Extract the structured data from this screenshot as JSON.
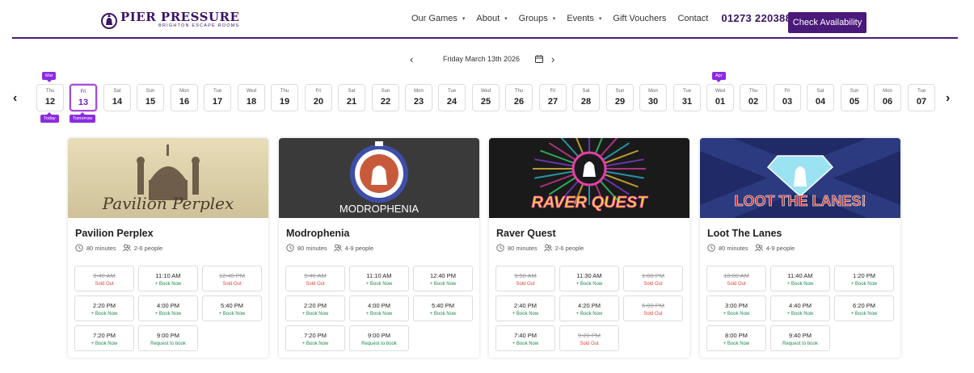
{
  "brand": {
    "name": "PIER PRESSURE",
    "tagline": "BRIGHTON ESCAPE ROOMS"
  },
  "nav": {
    "items": [
      {
        "label": "Our Games",
        "caret": true
      },
      {
        "label": "About",
        "caret": true
      },
      {
        "label": "Groups",
        "caret": true
      },
      {
        "label": "Events",
        "caret": true
      },
      {
        "label": "Gift Vouchers",
        "caret": false
      },
      {
        "label": "Contact",
        "caret": false
      }
    ],
    "phone": "01273 220388",
    "cta": "Check Availability"
  },
  "date_nav": {
    "current": "Friday March 13th 2026"
  },
  "days": [
    {
      "dn": "Thu",
      "dd": "12",
      "top_tag": "Mar",
      "bottom_tag": "Today"
    },
    {
      "dn": "Fri",
      "dd": "13",
      "bottom_tag": "Tomorrow",
      "selected": true
    },
    {
      "dn": "Sat",
      "dd": "14"
    },
    {
      "dn": "Sun",
      "dd": "15"
    },
    {
      "dn": "Mon",
      "dd": "16"
    },
    {
      "dn": "Tue",
      "dd": "17"
    },
    {
      "dn": "Wed",
      "dd": "18"
    },
    {
      "dn": "Thu",
      "dd": "19"
    },
    {
      "dn": "Fri",
      "dd": "20"
    },
    {
      "dn": "Sat",
      "dd": "21"
    },
    {
      "dn": "Sun",
      "dd": "22"
    },
    {
      "dn": "Mon",
      "dd": "23"
    },
    {
      "dn": "Tue",
      "dd": "24"
    },
    {
      "dn": "Wed",
      "dd": "25"
    },
    {
      "dn": "Thu",
      "dd": "26"
    },
    {
      "dn": "Fri",
      "dd": "27"
    },
    {
      "dn": "Sat",
      "dd": "28"
    },
    {
      "dn": "Sun",
      "dd": "29"
    },
    {
      "dn": "Mon",
      "dd": "30"
    },
    {
      "dn": "Tue",
      "dd": "31"
    },
    {
      "dn": "Wed",
      "dd": "01",
      "top_tag": "Apr"
    },
    {
      "dn": "Thu",
      "dd": "02"
    },
    {
      "dn": "Fri",
      "dd": "03"
    },
    {
      "dn": "Sat",
      "dd": "04"
    },
    {
      "dn": "Sun",
      "dd": "05"
    },
    {
      "dn": "Mon",
      "dd": "06"
    },
    {
      "dn": "Tue",
      "dd": "07"
    }
  ],
  "games": [
    {
      "title": "Pavilion Perplex",
      "art_text": "Pavilion Perplex",
      "duration": "80 minutes",
      "people": "2-6 people",
      "slots": [
        {
          "time": "9:40 AM",
          "status": "Sold Out",
          "kind": "sold"
        },
        {
          "time": "11:10 AM",
          "status": "+ Book Now",
          "kind": "book"
        },
        {
          "time": "12:40 PM",
          "status": "Sold Out",
          "kind": "sold"
        },
        {
          "time": "2:20 PM",
          "status": "+ Book Now",
          "kind": "book"
        },
        {
          "time": "4:00 PM",
          "status": "+ Book Now",
          "kind": "book"
        },
        {
          "time": "5:40 PM",
          "status": "+ Book Now",
          "kind": "book"
        },
        {
          "time": "7:20 PM",
          "status": "+ Book Now",
          "kind": "book"
        },
        {
          "time": "9:00 PM",
          "status": "Request to book",
          "kind": "req"
        }
      ]
    },
    {
      "title": "Modrophenia",
      "art_text": "MODROPHENIA",
      "duration": "80 minutes",
      "people": "4-9 people",
      "slots": [
        {
          "time": "9:40 AM",
          "status": "Sold Out",
          "kind": "sold"
        },
        {
          "time": "11:10 AM",
          "status": "+ Book Now",
          "kind": "book"
        },
        {
          "time": "12:40 PM",
          "status": "+ Book Now",
          "kind": "book"
        },
        {
          "time": "2:20 PM",
          "status": "+ Book Now",
          "kind": "book"
        },
        {
          "time": "4:00 PM",
          "status": "+ Book Now",
          "kind": "book"
        },
        {
          "time": "5:40 PM",
          "status": "+ Book Now",
          "kind": "book"
        },
        {
          "time": "7:20 PM",
          "status": "+ Book Now",
          "kind": "book"
        },
        {
          "time": "9:00 PM",
          "status": "Request to book",
          "kind": "req"
        }
      ]
    },
    {
      "title": "Raver Quest",
      "art_text": "RAVER QUEST",
      "duration": "80 minutes",
      "people": "2-6 people",
      "slots": [
        {
          "time": "9:50 AM",
          "status": "Sold Out",
          "kind": "sold"
        },
        {
          "time": "11:30 AM",
          "status": "+ Book Now",
          "kind": "book"
        },
        {
          "time": "1:00 PM",
          "status": "Sold Out",
          "kind": "sold"
        },
        {
          "time": "2:40 PM",
          "status": "+ Book Now",
          "kind": "book"
        },
        {
          "time": "4:20 PM",
          "status": "+ Book Now",
          "kind": "book"
        },
        {
          "time": "6:00 PM",
          "status": "Sold Out",
          "kind": "sold"
        },
        {
          "time": "7:40 PM",
          "status": "+ Book Now",
          "kind": "book"
        },
        {
          "time": "9:20 PM",
          "status": "Sold Out",
          "kind": "sold"
        }
      ]
    },
    {
      "title": "Loot The Lanes",
      "art_text": "LOOT THE LANES!",
      "duration": "80 minutes",
      "people": "4-9 people",
      "slots": [
        {
          "time": "10:00 AM",
          "status": "Sold Out",
          "kind": "sold"
        },
        {
          "time": "11:40 AM",
          "status": "+ Book Now",
          "kind": "book"
        },
        {
          "time": "1:20 PM",
          "status": "+ Book Now",
          "kind": "book"
        },
        {
          "time": "3:00 PM",
          "status": "+ Book Now",
          "kind": "book"
        },
        {
          "time": "4:40 PM",
          "status": "+ Book Now",
          "kind": "book"
        },
        {
          "time": "6:20 PM",
          "status": "+ Book Now",
          "kind": "book"
        },
        {
          "time": "8:00 PM",
          "status": "+ Book Now",
          "kind": "book"
        },
        {
          "time": "9:40 PM",
          "status": "Request to book",
          "kind": "req"
        }
      ]
    }
  ],
  "colors": {
    "brand": "#4a1a7a",
    "accent": "#8b2be2",
    "sold": "#e0463c",
    "book": "#1f8a4c"
  },
  "icons": {
    "prev": "chevron-left-icon",
    "next": "chevron-right-icon",
    "calendar": "calendar-icon",
    "clock": "clock-icon",
    "people": "people-icon"
  }
}
